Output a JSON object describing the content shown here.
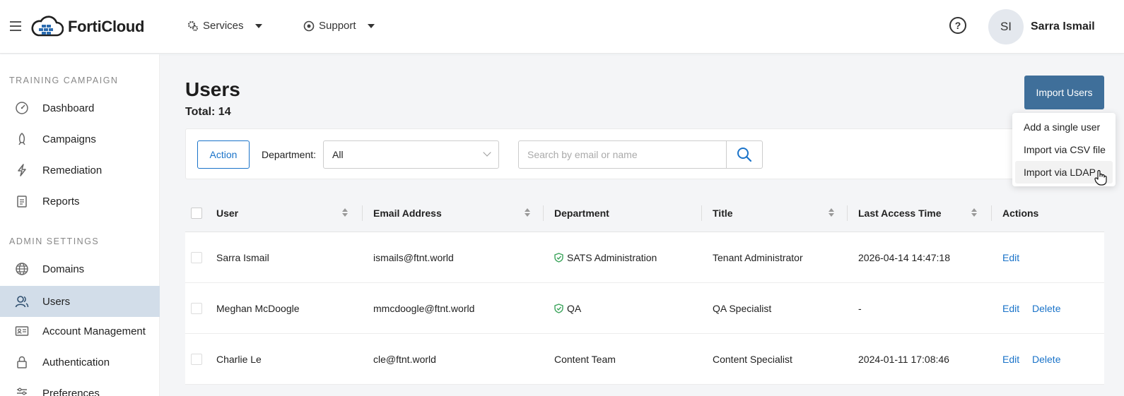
{
  "header": {
    "logo_text": "FortiCloud",
    "nav": [
      {
        "label": "Services"
      },
      {
        "label": "Support"
      }
    ],
    "help_glyph": "?",
    "user_initials": "SI",
    "user_name": "Sarra Ismail"
  },
  "sidebar": {
    "sections": [
      {
        "heading": "TRAINING CAMPAIGN",
        "items": [
          {
            "label": "Dashboard",
            "icon": "dashboard-icon"
          },
          {
            "label": "Campaigns",
            "icon": "rocket-icon"
          },
          {
            "label": "Remediation",
            "icon": "lightning-icon"
          },
          {
            "label": "Reports",
            "icon": "clipboard-icon"
          }
        ]
      },
      {
        "heading": "ADMIN SETTINGS",
        "items": [
          {
            "label": "Domains",
            "icon": "globe-icon"
          },
          {
            "label": "Users",
            "icon": "users-icon",
            "active": true
          },
          {
            "label": "Account Management",
            "icon": "id-card-icon"
          },
          {
            "label": "Authentication",
            "icon": "lock-icon"
          },
          {
            "label": "Preferences",
            "icon": "sliders-icon"
          }
        ]
      }
    ]
  },
  "main": {
    "title": "Users",
    "total": "Total: 14",
    "import_button": "Import Users",
    "import_menu": [
      "Add a single user",
      "Import via CSV file",
      "Import via LDAP"
    ],
    "filters": {
      "action_label": "Action",
      "department_label": "Department:",
      "department_value": "All",
      "search_placeholder": "Search by email or name"
    },
    "table": {
      "columns": [
        "User",
        "Email Address",
        "Department",
        "Title",
        "Last Access Time",
        "Actions"
      ],
      "rows": [
        {
          "user": "Sarra Ismail",
          "email": "ismails@ftnt.world",
          "department": "SATS Administration",
          "verified": true,
          "title": "Tenant Administrator",
          "last_access": "2026-04-14 14:47:18",
          "actions": [
            "Edit"
          ]
        },
        {
          "user": "Meghan McDoogle",
          "email": "mmcdoogle@ftnt.world",
          "department": "QA",
          "verified": true,
          "title": "QA Specialist",
          "last_access": "-",
          "actions": [
            "Edit",
            "Delete"
          ]
        },
        {
          "user": "Charlie Le",
          "email": "cle@ftnt.world",
          "department": "Content Team",
          "verified": false,
          "title": "Content Specialist",
          "last_access": "2024-01-11 17:08:46",
          "actions": [
            "Edit",
            "Delete"
          ]
        }
      ]
    }
  },
  "colors": {
    "primary_button": "#3f6f9a",
    "link": "#1a73c9",
    "active_sidebar": "#d2dde9",
    "verified_shield": "#3aa35a"
  }
}
